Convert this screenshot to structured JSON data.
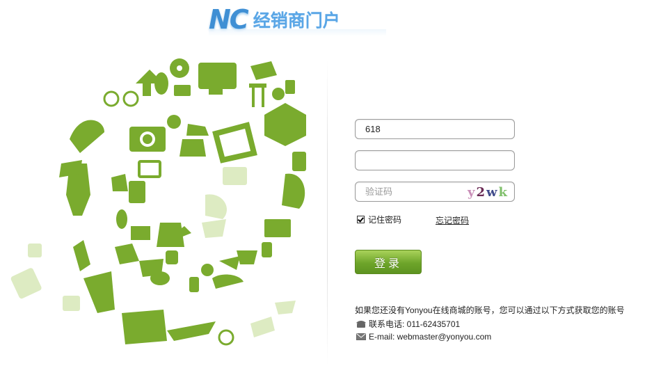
{
  "header": {
    "logo_nc": "NC",
    "logo_text": "经销商门户"
  },
  "form": {
    "username_value": "618",
    "password_value": "",
    "captcha_placeholder": "验证码",
    "captcha_chars": [
      "y",
      "2",
      "w",
      "k"
    ],
    "remember_label": "记住密码",
    "remember_checked": true,
    "forgot_label": "忘记密码",
    "login_label": "登录"
  },
  "info": {
    "intro": "如果您还没有Yonyou在线商城的账号，您可以通过以下方式获取您的账号",
    "phone": "联系电话: 011-62435701",
    "email": "E-mail: webmaster@yonyou.com"
  },
  "colors": {
    "accent_green": "#7aab2e",
    "logo_blue": "#3f8fd4"
  }
}
